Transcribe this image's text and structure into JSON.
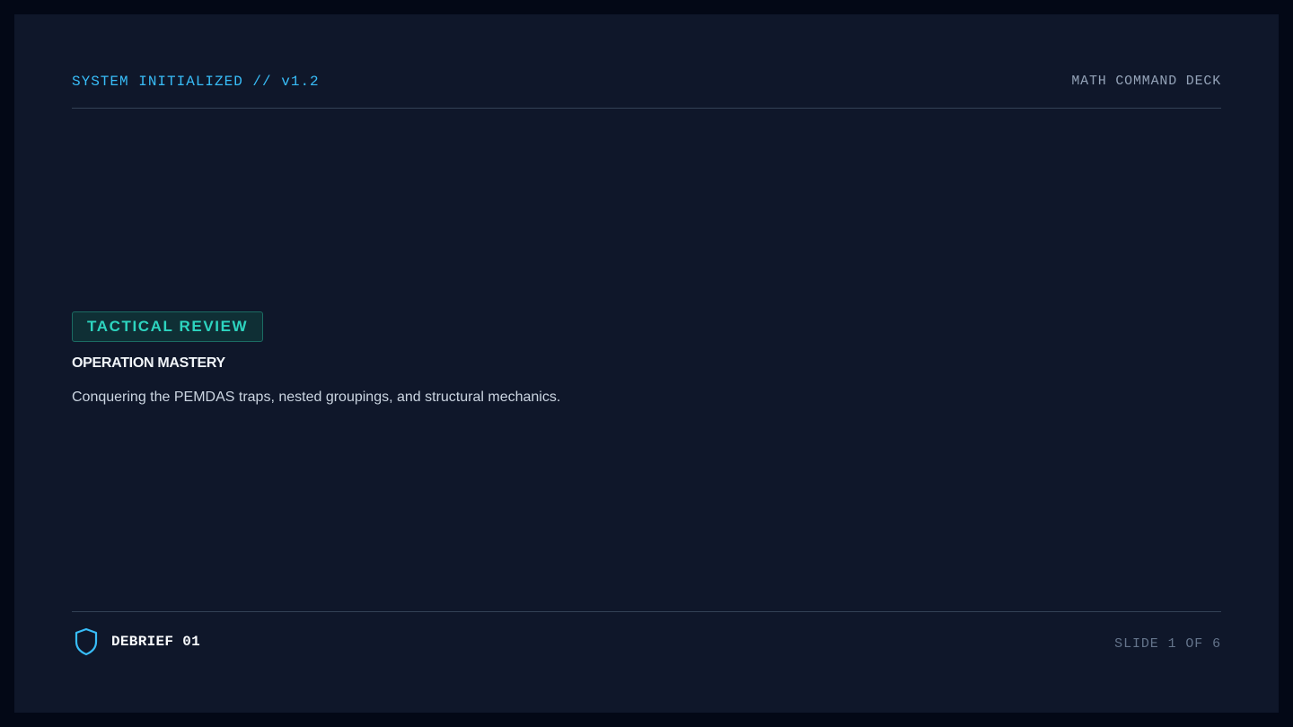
{
  "header": {
    "system_status": "SYSTEM INITIALIZED // v1.2",
    "deck_name": "MATH COMMAND DECK"
  },
  "main": {
    "badge_label": "TACTICAL REVIEW",
    "title": "OPERATION MASTERY",
    "subtitle": "Conquering the PEMDAS traps, nested groupings, and structural mechanics."
  },
  "footer": {
    "icon": "shield-icon",
    "label": "DEBRIEF 01",
    "slide_counter": "SLIDE 1 OF 6"
  },
  "colors": {
    "accent_cyan": "#38bdf8",
    "accent_teal": "#2dd4bf",
    "background": "#0f172a"
  }
}
